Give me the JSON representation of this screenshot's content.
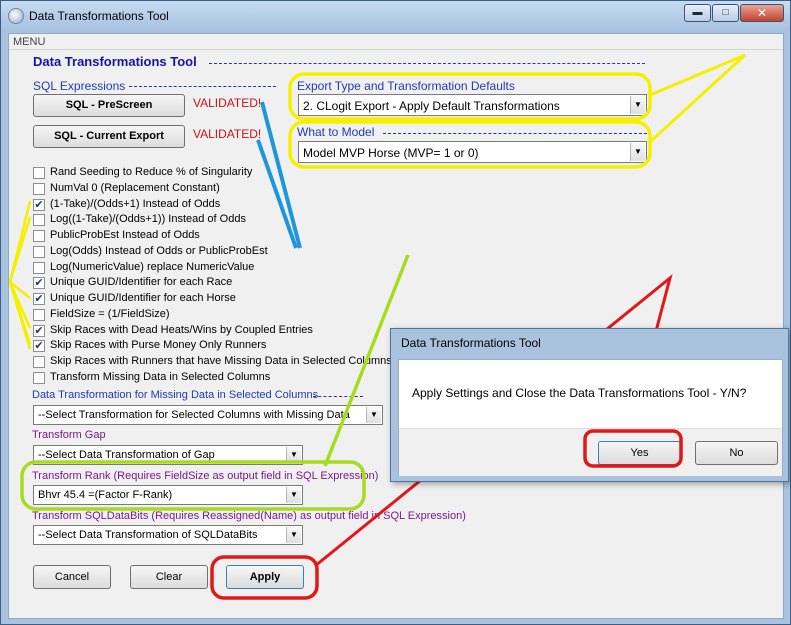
{
  "window": {
    "title": "Data Transformations Tool",
    "controls": {
      "minimize": "▬",
      "maximize": "□",
      "close": "✕"
    }
  },
  "menu": {
    "label": "MENU"
  },
  "header": {
    "title": "Data Transformations Tool"
  },
  "sql": {
    "section_label": "SQL Expressions",
    "prescreen_label": "SQL - PreScreen",
    "prescreen_status": "VALIDATED!",
    "export_label": "SQL - Current Export",
    "export_status": "VALIDATED!"
  },
  "export_type": {
    "label": "Export Type and Transformation Defaults",
    "value": "2. CLogit Export - Apply Default Transformations"
  },
  "what_to_model": {
    "label": "What to Model",
    "value": "Model MVP Horse (MVP= 1 or 0)"
  },
  "options": [
    {
      "label": "Rand Seeding to Reduce % of Singularity",
      "checked": false
    },
    {
      "label": "NumVal 0 (Replacement Constant)",
      "checked": false
    },
    {
      "label": "(1-Take)/(Odds+1) Instead of Odds",
      "checked": true
    },
    {
      "label": "Log((1-Take)/(Odds+1)) Instead of Odds",
      "checked": false
    },
    {
      "label": "PublicProbEst Instead of Odds",
      "checked": false
    },
    {
      "label": "Log(Odds) Instead of Odds or PublicProbEst",
      "checked": false
    },
    {
      "label": "Log(NumericValue) replace NumericValue",
      "checked": false
    },
    {
      "label": "Unique GUID/Identifier for each Race",
      "checked": true
    },
    {
      "label": "Unique GUID/Identifier for each Horse",
      "checked": true
    },
    {
      "label": "FieldSize = (1/FieldSize)",
      "checked": false
    },
    {
      "label": "Skip Races with Dead Heats/Wins by Coupled Entries",
      "checked": true
    },
    {
      "label": "Skip Races with Purse Money Only Runners",
      "checked": true
    },
    {
      "label": "Skip Races with Runners that have Missing Data in Selected Columns",
      "checked": false
    },
    {
      "label": "Transform Missing Data in Selected Columns",
      "checked": false
    }
  ],
  "missing_data": {
    "label": "Data Transformation for Missing Data in Selected Columns",
    "value": "--Select Transformation for Selected Columns with Missing Data"
  },
  "gap": {
    "label": "Transform Gap",
    "value": "--Select Data Transformation of Gap"
  },
  "rank": {
    "label": "Transform Rank (Requires FieldSize as output field in SQL Expression)",
    "value": "Bhvr 45.4 =(Factor F-Rank)"
  },
  "sqldatabits": {
    "label": "Transform SQLDataBits (Requires Reassigned(Name) as output field in SQL Expression)",
    "value": "--Select Data Transformation of SQLDataBits"
  },
  "buttons": {
    "cancel": "Cancel",
    "clear": "Clear",
    "apply": "Apply"
  },
  "dialog": {
    "title": "Data Transformations Tool",
    "message": "Apply Settings and Close the Data Transformations Tool - Y/N?",
    "yes": "Yes",
    "no": "No"
  },
  "colors": {
    "highlight_yellow": "#f5f000",
    "highlight_green": "#a6dc1e",
    "highlight_red": "#e01818",
    "highlight_blue": "#1e96dc"
  }
}
